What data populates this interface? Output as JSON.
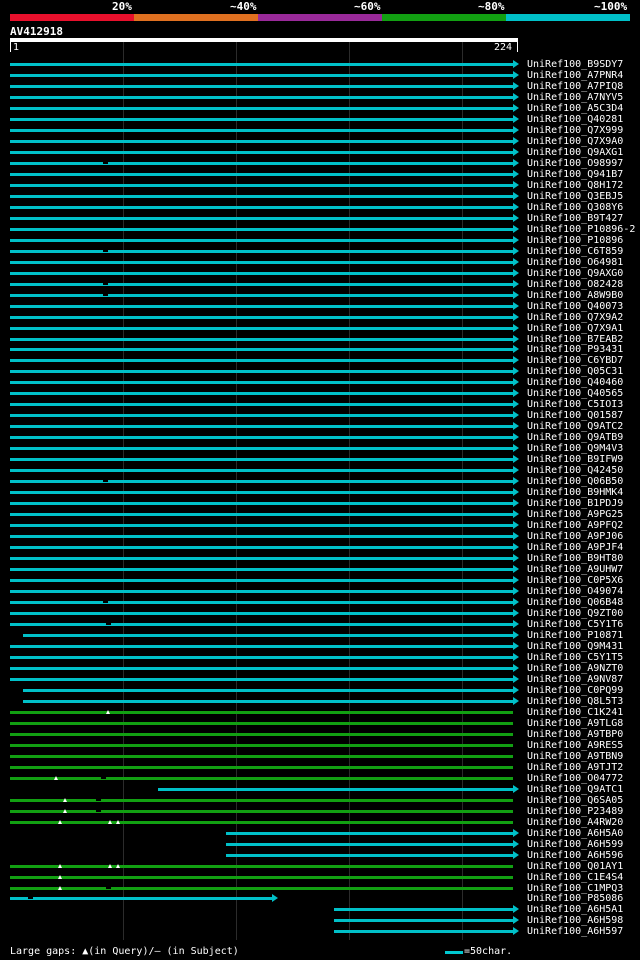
{
  "legend": {
    "labels": [
      "20%",
      "~40%",
      "~60%",
      "~80%",
      "~100%"
    ],
    "colors": [
      "#e8102c",
      "#e07020",
      "#9a2a9a",
      "#12a012",
      "#00c0c8"
    ]
  },
  "query": {
    "id": "AV412918",
    "start": "1",
    "end": "224"
  },
  "hits": [
    {
      "name": "UniRef100_B9SDY7",
      "color": "cyan",
      "start": 0,
      "end": 1,
      "gaps": [],
      "tris": []
    },
    {
      "name": "UniRef100_A7PNR4",
      "color": "cyan",
      "start": 0,
      "end": 1,
      "gaps": [],
      "tris": []
    },
    {
      "name": "UniRef100_A7PIQ8",
      "color": "cyan",
      "start": 0,
      "end": 1,
      "gaps": [],
      "tris": []
    },
    {
      "name": "UniRef100_A7NYV5",
      "color": "cyan",
      "start": 0,
      "end": 1,
      "gaps": [],
      "tris": []
    },
    {
      "name": "UniRef100_A5C3D4",
      "color": "cyan",
      "start": 0,
      "end": 1,
      "gaps": [],
      "tris": []
    },
    {
      "name": "UniRef100_Q40281",
      "color": "cyan",
      "start": 0,
      "end": 1,
      "gaps": [],
      "tris": []
    },
    {
      "name": "UniRef100_Q7X999",
      "color": "cyan",
      "start": 0,
      "end": 1,
      "gaps": [],
      "tris": []
    },
    {
      "name": "UniRef100_Q7X9A0",
      "color": "cyan",
      "start": 0,
      "end": 1,
      "gaps": [],
      "tris": []
    },
    {
      "name": "UniRef100_Q9AXG1",
      "color": "cyan",
      "start": 0,
      "end": 1,
      "gaps": [],
      "tris": []
    },
    {
      "name": "UniRef100_O98997",
      "color": "cyan",
      "start": 0,
      "end": 1,
      "gaps": [
        0.185
      ],
      "tris": []
    },
    {
      "name": "UniRef100_Q941B7",
      "color": "cyan",
      "start": 0,
      "end": 1,
      "gaps": [],
      "tris": []
    },
    {
      "name": "UniRef100_Q8H172",
      "color": "cyan",
      "start": 0,
      "end": 1,
      "gaps": [],
      "tris": []
    },
    {
      "name": "UniRef100_Q3EBJ5",
      "color": "cyan",
      "start": 0,
      "end": 1,
      "gaps": [],
      "tris": []
    },
    {
      "name": "UniRef100_Q308Y6",
      "color": "cyan",
      "start": 0,
      "end": 1,
      "gaps": [],
      "tris": []
    },
    {
      "name": "UniRef100_B9T427",
      "color": "cyan",
      "start": 0,
      "end": 1,
      "gaps": [],
      "tris": []
    },
    {
      "name": "UniRef100_P10896-2",
      "color": "cyan",
      "start": 0,
      "end": 1,
      "gaps": [],
      "tris": []
    },
    {
      "name": "UniRef100_P10896",
      "color": "cyan",
      "start": 0,
      "end": 1,
      "gaps": [],
      "tris": []
    },
    {
      "name": "UniRef100_C6T859",
      "color": "cyan",
      "start": 0,
      "end": 1,
      "gaps": [
        0.185
      ],
      "tris": []
    },
    {
      "name": "UniRef100_O64981",
      "color": "cyan",
      "start": 0,
      "end": 1,
      "gaps": [],
      "tris": []
    },
    {
      "name": "UniRef100_Q9AXG0",
      "color": "cyan",
      "start": 0,
      "end": 1,
      "gaps": [],
      "tris": []
    },
    {
      "name": "UniRef100_O82428",
      "color": "cyan",
      "start": 0,
      "end": 1,
      "gaps": [
        0.185
      ],
      "tris": []
    },
    {
      "name": "UniRef100_A8W9B0",
      "color": "cyan",
      "start": 0,
      "end": 1,
      "gaps": [
        0.185
      ],
      "tris": []
    },
    {
      "name": "UniRef100_Q40073",
      "color": "cyan",
      "start": 0,
      "end": 1,
      "gaps": [],
      "tris": []
    },
    {
      "name": "UniRef100_Q7X9A2",
      "color": "cyan",
      "start": 0,
      "end": 1,
      "gaps": [],
      "tris": []
    },
    {
      "name": "UniRef100_Q7X9A1",
      "color": "cyan",
      "start": 0,
      "end": 1,
      "gaps": [],
      "tris": []
    },
    {
      "name": "UniRef100_B7EAB2",
      "color": "cyan",
      "start": 0,
      "end": 1,
      "gaps": [],
      "tris": []
    },
    {
      "name": "UniRef100_P93431",
      "color": "cyan",
      "start": 0,
      "end": 1,
      "gaps": [],
      "tris": []
    },
    {
      "name": "UniRef100_C6YBD7",
      "color": "cyan",
      "start": 0,
      "end": 1,
      "gaps": [],
      "tris": []
    },
    {
      "name": "UniRef100_Q05C31",
      "color": "cyan",
      "start": 0,
      "end": 1,
      "gaps": [],
      "tris": []
    },
    {
      "name": "UniRef100_Q40460",
      "color": "cyan",
      "start": 0,
      "end": 1,
      "gaps": [],
      "tris": []
    },
    {
      "name": "UniRef100_Q40565",
      "color": "cyan",
      "start": 0,
      "end": 1,
      "gaps": [],
      "tris": []
    },
    {
      "name": "UniRef100_C5IOI3",
      "color": "cyan",
      "start": 0,
      "end": 1,
      "gaps": [],
      "tris": []
    },
    {
      "name": "UniRef100_Q01587",
      "color": "cyan",
      "start": 0,
      "end": 1,
      "gaps": [],
      "tris": []
    },
    {
      "name": "UniRef100_Q9ATC2",
      "color": "cyan",
      "start": 0,
      "end": 1,
      "gaps": [],
      "tris": []
    },
    {
      "name": "UniRef100_Q9ATB9",
      "color": "cyan",
      "start": 0,
      "end": 1,
      "gaps": [],
      "tris": []
    },
    {
      "name": "UniRef100_Q9M4V3",
      "color": "cyan",
      "start": 0,
      "end": 1,
      "gaps": [],
      "tris": []
    },
    {
      "name": "UniRef100_B9IFW9",
      "color": "cyan",
      "start": 0,
      "end": 1,
      "gaps": [],
      "tris": []
    },
    {
      "name": "UniRef100_Q42450",
      "color": "cyan",
      "start": 0,
      "end": 1,
      "gaps": [],
      "tris": []
    },
    {
      "name": "UniRef100_Q06B50",
      "color": "cyan",
      "start": 0,
      "end": 1,
      "gaps": [
        0.185
      ],
      "tris": []
    },
    {
      "name": "UniRef100_B9HMK4",
      "color": "cyan",
      "start": 0,
      "end": 1,
      "gaps": [],
      "tris": []
    },
    {
      "name": "UniRef100_B1PDJ9",
      "color": "cyan",
      "start": 0,
      "end": 1,
      "gaps": [],
      "tris": []
    },
    {
      "name": "UniRef100_A9PG25",
      "color": "cyan",
      "start": 0,
      "end": 1,
      "gaps": [],
      "tris": []
    },
    {
      "name": "UniRef100_A9PFQ2",
      "color": "cyan",
      "start": 0,
      "end": 1,
      "gaps": [],
      "tris": []
    },
    {
      "name": "UniRef100_A9PJ06",
      "color": "cyan",
      "start": 0,
      "end": 1,
      "gaps": [],
      "tris": []
    },
    {
      "name": "UniRef100_A9PJF4",
      "color": "cyan",
      "start": 0,
      "end": 1,
      "gaps": [],
      "tris": []
    },
    {
      "name": "UniRef100_B9HT80",
      "color": "cyan",
      "start": 0,
      "end": 1,
      "gaps": [],
      "tris": []
    },
    {
      "name": "UniRef100_A9UHW7",
      "color": "cyan",
      "start": 0,
      "end": 1,
      "gaps": [],
      "tris": []
    },
    {
      "name": "UniRef100_C0P5X6",
      "color": "cyan",
      "start": 0,
      "end": 1,
      "gaps": [],
      "tris": []
    },
    {
      "name": "UniRef100_O49074",
      "color": "cyan",
      "start": 0,
      "end": 1,
      "gaps": [],
      "tris": []
    },
    {
      "name": "UniRef100_Q06B48",
      "color": "cyan",
      "start": 0,
      "end": 1,
      "gaps": [
        0.185
      ],
      "tris": []
    },
    {
      "name": "UniRef100_Q9ZT00",
      "color": "cyan",
      "start": 0,
      "end": 1,
      "gaps": [],
      "tris": []
    },
    {
      "name": "UniRef100_C5Y1T6",
      "color": "cyan",
      "start": 0,
      "end": 1,
      "gaps": [
        0.19
      ],
      "tris": []
    },
    {
      "name": "UniRef100_P10871",
      "color": "cyan",
      "start": 0.026,
      "end": 1,
      "gaps": [],
      "tris": []
    },
    {
      "name": "UniRef100_Q9M431",
      "color": "cyan",
      "start": 0,
      "end": 1,
      "gaps": [],
      "tris": []
    },
    {
      "name": "UniRef100_C5Y1T5",
      "color": "cyan",
      "start": 0,
      "end": 1,
      "gaps": [],
      "tris": []
    },
    {
      "name": "UniRef100_A9NZT0",
      "color": "cyan",
      "start": 0,
      "end": 1,
      "gaps": [],
      "tris": []
    },
    {
      "name": "UniRef100_A9NV87",
      "color": "cyan",
      "start": 0,
      "end": 1,
      "gaps": [],
      "tris": []
    },
    {
      "name": "UniRef100_C0PQ99",
      "color": "cyan",
      "start": 0.026,
      "end": 1,
      "gaps": [],
      "tris": []
    },
    {
      "name": "UniRef100_Q8L5T3",
      "color": "cyan",
      "start": 0.026,
      "end": 1,
      "gaps": [],
      "tris": []
    },
    {
      "name": "UniRef100_C1K241",
      "color": "green",
      "start": 0,
      "end": 1,
      "gaps": [],
      "tris": [
        0.19
      ]
    },
    {
      "name": "UniRef100_A9TLG8",
      "color": "green",
      "start": 0,
      "end": 1,
      "gaps": [],
      "tris": []
    },
    {
      "name": "UniRef100_A9TBP0",
      "color": "green",
      "start": 0,
      "end": 1,
      "gaps": [],
      "tris": []
    },
    {
      "name": "UniRef100_A9RES5",
      "color": "green",
      "start": 0,
      "end": 1,
      "gaps": [],
      "tris": []
    },
    {
      "name": "UniRef100_A9TBN9",
      "color": "green",
      "start": 0,
      "end": 1,
      "gaps": [],
      "tris": []
    },
    {
      "name": "UniRef100_A9TJT2",
      "color": "green",
      "start": 0,
      "end": 1,
      "gaps": [],
      "tris": []
    },
    {
      "name": "UniRef100_O04772",
      "color": "green",
      "start": 0,
      "end": 1,
      "gaps": [
        0.18
      ],
      "tris": [
        0.087
      ]
    },
    {
      "name": "UniRef100_Q9ATC1",
      "color": "cyan",
      "start": 0.295,
      "end": 1,
      "gaps": [],
      "tris": []
    },
    {
      "name": "UniRef100_Q6SA05",
      "color": "green",
      "start": 0,
      "end": 1,
      "gaps": [
        0.17
      ],
      "tris": [
        0.105
      ]
    },
    {
      "name": "UniRef100_P23489",
      "color": "green",
      "start": 0,
      "end": 1,
      "gaps": [
        0.17
      ],
      "tris": [
        0.105
      ]
    },
    {
      "name": "UniRef100_A4RW20",
      "color": "green",
      "start": 0,
      "end": 1,
      "gaps": [],
      "tris": [
        0.095,
        0.195,
        0.21
      ]
    },
    {
      "name": "UniRef100_A6H5A0",
      "color": "cyan",
      "start": 0.43,
      "end": 1,
      "gaps": [],
      "tris": []
    },
    {
      "name": "UniRef100_A6H599",
      "color": "cyan",
      "start": 0.43,
      "end": 1,
      "gaps": [],
      "tris": []
    },
    {
      "name": "UniRef100_A6H596",
      "color": "cyan",
      "start": 0.43,
      "end": 1,
      "gaps": [],
      "tris": []
    },
    {
      "name": "UniRef100_Q01AY1",
      "color": "green",
      "start": 0,
      "end": 1,
      "gaps": [],
      "tris": [
        0.095,
        0.195,
        0.21
      ]
    },
    {
      "name": "UniRef100_C1E4S4",
      "color": "green",
      "start": 0,
      "end": 1,
      "gaps": [],
      "tris": [
        0.095
      ]
    },
    {
      "name": "UniRef100_C1MPQ3",
      "color": "green",
      "start": 0,
      "end": 1,
      "gaps": [
        0.19
      ],
      "tris": [
        0.095
      ]
    },
    {
      "name": "UniRef100_P85086",
      "color": "cyan",
      "start": 0,
      "end": 0.52,
      "gaps": [
        0.035
      ],
      "tris": []
    },
    {
      "name": "UniRef100_A6H5A1",
      "color": "cyan",
      "start": 0.645,
      "end": 1,
      "gaps": [],
      "tris": []
    },
    {
      "name": "UniRef100_A6H598",
      "color": "cyan",
      "start": 0.645,
      "end": 1,
      "gaps": [],
      "tris": []
    },
    {
      "name": "UniRef100_A6H597",
      "color": "cyan",
      "start": 0.645,
      "end": 1,
      "gaps": [],
      "tris": []
    }
  ],
  "hit_colors": {
    "cyan": "#00c0c8",
    "green": "#12a012"
  },
  "footer": {
    "label": "Large gaps: ▲(in Query)/– (in Subject)",
    "scale": "=50char."
  }
}
